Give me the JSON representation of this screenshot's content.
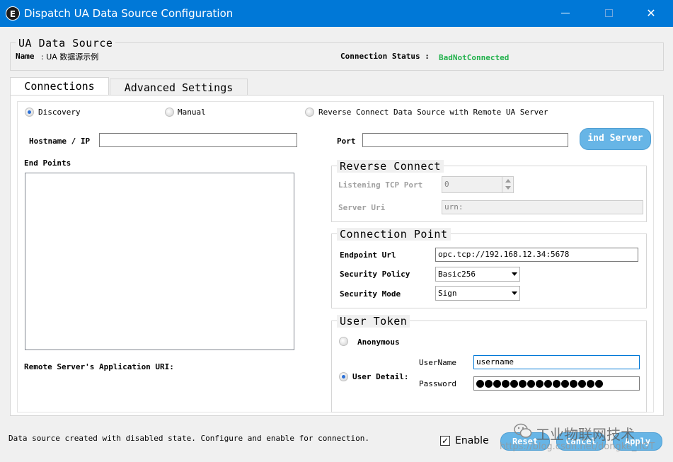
{
  "window": {
    "icon_letter": "E",
    "title": "Dispatch UA Data Source Configuration",
    "minimize_glyph": "—",
    "maximize_glyph": "☐",
    "close_glyph": "✕"
  },
  "data_source": {
    "group_title": "UA Data Source",
    "name_label": "Name",
    "name_value": ": UA 数据源示例",
    "status_label": "Connection Status :",
    "status_value": "BadNotConnected",
    "status_color": "#22b14c"
  },
  "tabs": [
    {
      "label": "Connections",
      "active": true
    },
    {
      "label": "Advanced Settings",
      "active": false
    }
  ],
  "connection_mode": {
    "options": [
      {
        "label": "Discovery",
        "checked": true
      },
      {
        "label": "Manual",
        "checked": false
      },
      {
        "label": "Reverse Connect Data Source with Remote UA Server",
        "checked": false
      }
    ]
  },
  "discovery": {
    "hostname_label": "Hostname / IP",
    "hostname_value": "",
    "port_label": "Port",
    "port_value": "",
    "find_server_label": "ind Server",
    "endpoints_label": "End Points",
    "remote_uri_label": "Remote Server's Application URI:"
  },
  "reverse_connect": {
    "group_title": "Reverse Connect",
    "listening_port_label": "Listening TCP Port",
    "listening_port_value": "0",
    "server_uri_label": "Server Uri",
    "server_uri_value": "urn:"
  },
  "connection_point": {
    "group_title": "Connection Point",
    "endpoint_url_label": "Endpoint Url",
    "endpoint_url_value": "opc.tcp://192.168.12.34:5678",
    "security_policy_label": "Security Policy",
    "security_policy_value": "Basic256",
    "security_mode_label": "Security Mode",
    "security_mode_value": "Sign"
  },
  "user_token": {
    "group_title": "User Token",
    "anonymous_label": "Anonymous",
    "anonymous_checked": false,
    "user_detail_label": "User Detail:",
    "user_detail_checked": true,
    "username_label": "UserName",
    "username_value": "username",
    "password_label": "Password",
    "password_length": 15
  },
  "footer": {
    "status_message": "Data source created with disabled state. Configure and enable for connection.",
    "enable_label": "Enable",
    "enable_checked": true,
    "reset_label": "Reset",
    "cancel_label": "Cancel",
    "apply_label": "Apply"
  },
  "watermark": {
    "brand_text": "工业物联网技术",
    "url_text": "https://blog.csdn.net/dongke_IIOT"
  }
}
